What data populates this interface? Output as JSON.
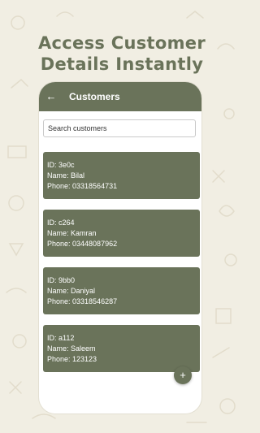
{
  "promo": {
    "headline_line1": "Access Customer",
    "headline_line2": "Details Instantly"
  },
  "appbar": {
    "back_icon": "arrow-left-icon",
    "title": "Customers"
  },
  "search": {
    "placeholder": "Search customers",
    "value": ""
  },
  "customers": [
    {
      "id": "ID: 3e0c",
      "name": "Name: Bilal",
      "phone": "Phone: 03318564731"
    },
    {
      "id": "ID: c264",
      "name": "Name: Kamran",
      "phone": "Phone: 03448087962"
    },
    {
      "id": "ID: 9bb0",
      "name": "Name: Daniyal",
      "phone": "Phone: 03318546287"
    },
    {
      "id": "ID: a112",
      "name": "Name: Saleem",
      "phone": "Phone: 123123"
    }
  ],
  "fab": {
    "icon": "plus-icon",
    "glyph": "+"
  },
  "colors": {
    "primary": "#6a735a",
    "background": "#f1eee3",
    "surface": "#ffffff"
  }
}
